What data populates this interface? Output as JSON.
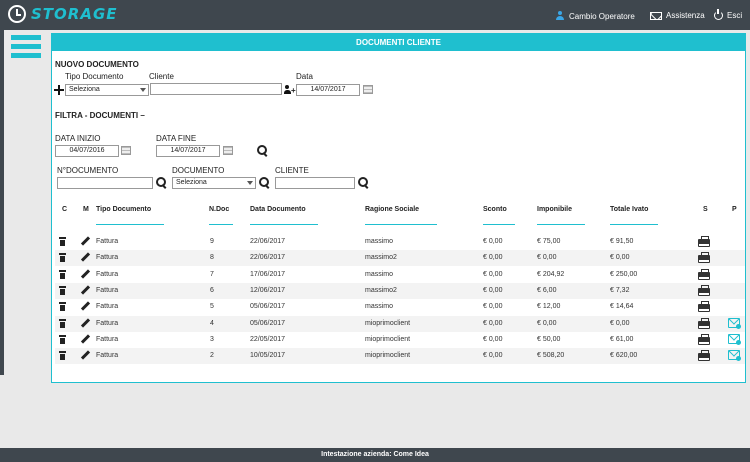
{
  "app": {
    "name": "STORAGE"
  },
  "topbar": {
    "operator_label": "Cambio Operatore",
    "assist_label": "Assistenza",
    "exit_label": "Esci"
  },
  "panel": {
    "title": "DOCUMENTI CLIENTE"
  },
  "new_doc": {
    "section_title": "NUOVO DOCUMENTO",
    "tipo_label": "Tipo Documento",
    "tipo_value": "Seleziona",
    "cliente_label": "Cliente",
    "cliente_value": "",
    "data_label": "Data",
    "data_value": "14/07/2017"
  },
  "filter": {
    "section_title": "FILTRA - DOCUMENTI –",
    "data_inizio_label": "DATA INIZIO",
    "data_inizio_value": "04/07/2016",
    "data_fine_label": "DATA FINE",
    "data_fine_value": "14/07/2017",
    "ndoc_label": "N°DOCUMENTO",
    "ndoc_value": "",
    "documento_label": "DOCUMENTO",
    "documento_value": "Seleziona",
    "cliente_label": "CLIENTE",
    "cliente_value": ""
  },
  "table": {
    "headers": {
      "c": "C",
      "m": "M",
      "tipo": "Tipo Documento",
      "ndoc": "N.Doc",
      "data": "Data Documento",
      "ragione": "Ragione Sociale",
      "sconto": "Sconto",
      "imponibile": "Imponibile",
      "totale": "Totale Ivato",
      "s": "S",
      "p": "P"
    },
    "rows": [
      {
        "tipo": "Fattura",
        "ndoc": "9",
        "data": "22/06/2017",
        "ragione": "massimo",
        "sconto": "€ 0,00",
        "imponibile": "€ 75,00",
        "totale": "€ 91,50",
        "mail": false
      },
      {
        "tipo": "Fattura",
        "ndoc": "8",
        "data": "22/06/2017",
        "ragione": "massimo2",
        "sconto": "€ 0,00",
        "imponibile": "€ 0,00",
        "totale": "€ 0,00",
        "mail": false
      },
      {
        "tipo": "Fattura",
        "ndoc": "7",
        "data": "17/06/2017",
        "ragione": "massimo",
        "sconto": "€ 0,00",
        "imponibile": "€ 204,92",
        "totale": "€ 250,00",
        "mail": false
      },
      {
        "tipo": "Fattura",
        "ndoc": "6",
        "data": "12/06/2017",
        "ragione": "massimo2",
        "sconto": "€ 0,00",
        "imponibile": "€ 6,00",
        "totale": "€ 7,32",
        "mail": false
      },
      {
        "tipo": "Fattura",
        "ndoc": "5",
        "data": "05/06/2017",
        "ragione": "massimo",
        "sconto": "€ 0,00",
        "imponibile": "€ 12,00",
        "totale": "€ 14,64",
        "mail": false
      },
      {
        "tipo": "Fattura",
        "ndoc": "4",
        "data": "05/06/2017",
        "ragione": "mioprimoclient",
        "sconto": "€ 0,00",
        "imponibile": "€ 0,00",
        "totale": "€ 0,00",
        "mail": true
      },
      {
        "tipo": "Fattura",
        "ndoc": "3",
        "data": "22/05/2017",
        "ragione": "mioprimoclient",
        "sconto": "€ 0,00",
        "imponibile": "€ 50,00",
        "totale": "€ 61,00",
        "mail": true
      },
      {
        "tipo": "Fattura",
        "ndoc": "2",
        "data": "10/05/2017",
        "ragione": "mioprimoclient",
        "sconto": "€ 0,00",
        "imponibile": "€ 508,20",
        "totale": "€ 620,00",
        "mail": true
      }
    ]
  },
  "footer": {
    "text": "Intestazione azienda: Come Idea"
  },
  "colors": {
    "accent": "#1fbfcf",
    "topbar": "#3f474e"
  }
}
